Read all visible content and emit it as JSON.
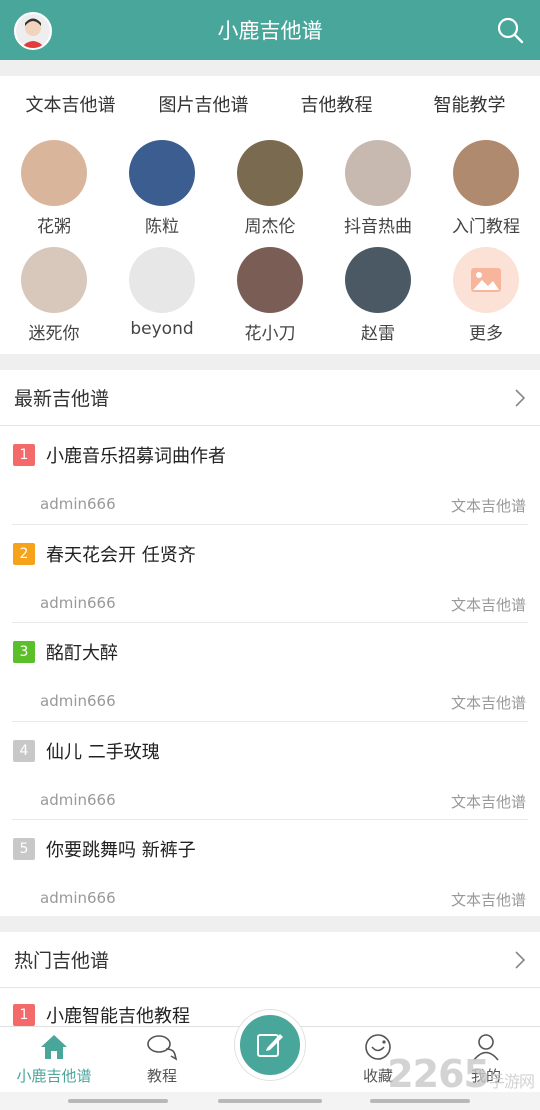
{
  "header": {
    "title": "小鹿吉他谱"
  },
  "categories": {
    "tabs": [
      "文本吉他谱",
      "图片吉他谱",
      "吉他教程",
      "智能教学"
    ],
    "artists": [
      {
        "name": "花粥",
        "bg": "#d9b59c"
      },
      {
        "name": "陈粒",
        "bg": "#3b5d8f"
      },
      {
        "name": "周杰伦",
        "bg": "#7a6a4f"
      },
      {
        "name": "抖音热曲",
        "bg": "#c7b8b0"
      },
      {
        "name": "入门教程",
        "bg": "#b08a6e"
      },
      {
        "name": "迷死你",
        "bg": "#d8c8bc"
      },
      {
        "name": "beyond",
        "bg": "#e7e7e7"
      },
      {
        "name": "花小刀",
        "bg": "#7a5e55"
      },
      {
        "name": "赵雷",
        "bg": "#4a5963"
      },
      {
        "name": "更多",
        "bg": "#fce1d6"
      }
    ]
  },
  "latest": {
    "title": "最新吉他谱",
    "items": [
      {
        "rank": "1",
        "title": "小鹿音乐招募词曲作者",
        "author": "admin666",
        "type": "文本吉他谱",
        "color": "#f46a6a"
      },
      {
        "rank": "2",
        "title": "春天花会开 任贤齐",
        "author": "admin666",
        "type": "文本吉他谱",
        "color": "#f7a21b"
      },
      {
        "rank": "3",
        "title": "酩酊大醉",
        "author": "admin666",
        "type": "文本吉他谱",
        "color": "#5bbf2a"
      },
      {
        "rank": "4",
        "title": "仙儿 二手玫瑰",
        "author": "admin666",
        "type": "文本吉他谱",
        "color": "#c8c8c8"
      },
      {
        "rank": "5",
        "title": "你要跳舞吗 新裤子",
        "author": "admin666",
        "type": "文本吉他谱",
        "color": "#c8c8c8"
      }
    ]
  },
  "hot": {
    "title": "热门吉他谱",
    "items": [
      {
        "rank": "1",
        "title": "小鹿智能吉他教程",
        "color": "#f46a6a"
      }
    ]
  },
  "tabbar": {
    "home": "小鹿吉他谱",
    "tutorial": "教程",
    "favorites": "收藏",
    "mine": "我的"
  },
  "watermark": {
    "text": "2265",
    "sub": "手游网"
  },
  "colors": {
    "primary": "#48a69b"
  }
}
